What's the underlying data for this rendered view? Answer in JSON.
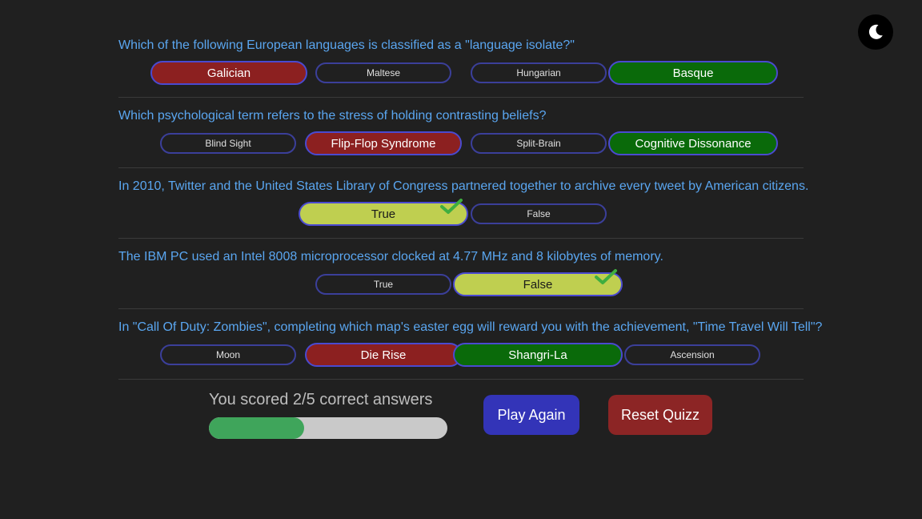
{
  "theme_toggle": {
    "icon": "moon-icon"
  },
  "questions": [
    {
      "text": "Which of the following European languages is classified as a \"language isolate?\"",
      "options": [
        "Galician",
        "Maltese",
        "Hungarian",
        "Basque"
      ],
      "states": [
        "wrong",
        "none",
        "none",
        "correct"
      ]
    },
    {
      "text": "Which psychological term refers to the stress of holding contrasting beliefs?",
      "options": [
        "Blind Sight",
        "Flip-Flop Syndrome",
        "Split-Brain",
        "Cognitive Dissonance"
      ],
      "states": [
        "none",
        "wrong",
        "none",
        "correct"
      ]
    },
    {
      "text": "In 2010, Twitter and the United States Library of Congress partnered together to archive every tweet by American citizens.",
      "options": [
        "True",
        "False"
      ],
      "states": [
        "chosen-right",
        "none"
      ]
    },
    {
      "text": "The IBM PC used an Intel 8008 microprocessor clocked at 4.77 MHz and 8 kilobytes of memory.",
      "options": [
        "True",
        "False"
      ],
      "states": [
        "none",
        "chosen-right"
      ]
    },
    {
      "text": "In \"Call Of Duty: Zombies\", completing which map's easter egg will reward you with the achievement, \"Time Travel Will Tell\"?",
      "options": [
        "Moon",
        "Die Rise",
        "Shangri-La",
        "Ascension"
      ],
      "states": [
        "none",
        "wrong",
        "correct",
        "none"
      ]
    }
  ],
  "result": {
    "score_text": "You scored 2/5 correct answers",
    "score": 2,
    "total": 5,
    "progress_fraction": 0.4
  },
  "buttons": {
    "play_again": "Play Again",
    "reset_quiz": "Reset Quizz"
  },
  "colors": {
    "question_text": "#5aa6f0",
    "wrong": "#8c2020",
    "correct": "#0a6a0a",
    "chosen_right": "#bfcf50",
    "progress_fill": "#3fa55b",
    "play_again": "#3334b8",
    "reset": "#8c2525"
  }
}
